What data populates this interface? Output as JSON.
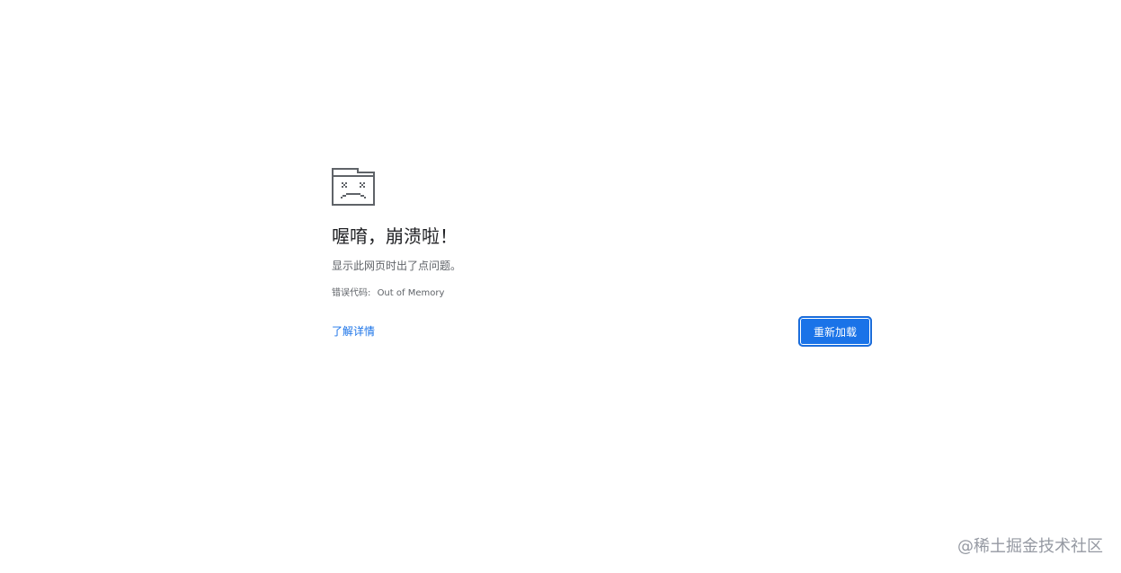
{
  "error_page": {
    "icon": "sad-tab-folder-icon",
    "title": "喔唷，崩溃啦！",
    "subtitle": "显示此网页时出了点问题。",
    "error_code_label": "错误代码:",
    "error_code_value": "Out of Memory",
    "learn_more_label": "了解详情",
    "reload_label": "重新加载"
  },
  "watermark": {
    "text": "@稀土掘金技术社区"
  },
  "colors": {
    "accent": "#1a73e8",
    "title": "#202124",
    "secondary_text": "#5f6368",
    "icon": "#5f6368",
    "background": "#ffffff"
  }
}
